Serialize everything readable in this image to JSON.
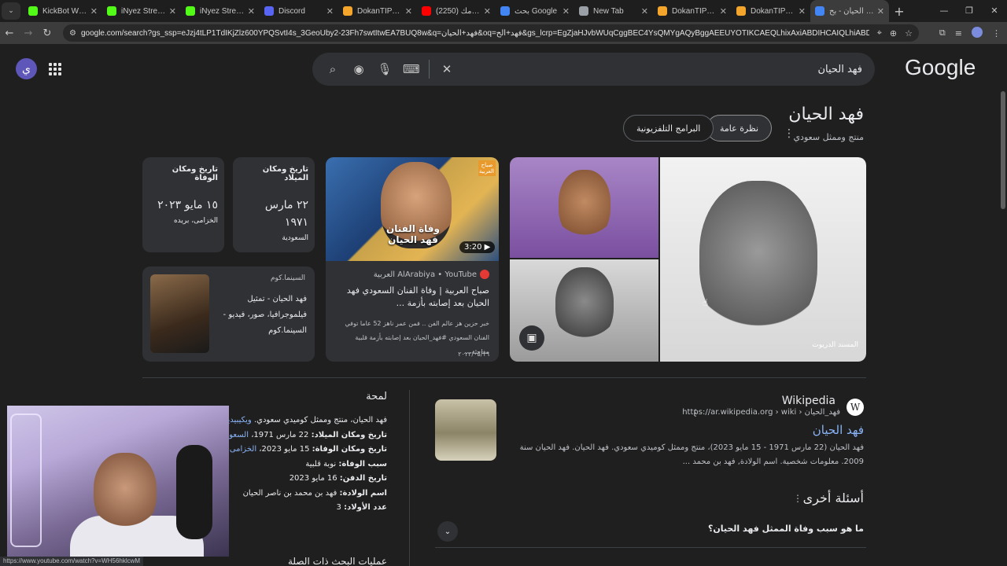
{
  "browser": {
    "tabs": [
      {
        "title": "KickBot Widget",
        "color": "#53fc18"
      },
      {
        "title": "iNyez Stream",
        "color": "#53fc18"
      },
      {
        "title": "iNyez Stream",
        "color": "#53fc18"
      },
      {
        "title": "Discord",
        "color": "#5865f2"
      },
      {
        "title": "DokanTIP | bro",
        "color": "#f4a52b"
      },
      {
        "title": "(2250) نزار مك",
        "color": "#ff0000"
      },
      {
        "title": "بحث Google",
        "color": "#4285f4"
      },
      {
        "title": "New Tab",
        "color": "#9aa0a6"
      },
      {
        "title": "DokanTIP - ية",
        "color": "#f4a52b"
      },
      {
        "title": "DokanTIP | iny",
        "color": "#f4a52b"
      },
      {
        "title": "فهد الحيان - بح",
        "color": "#4285f4"
      }
    ],
    "new_tab": "+",
    "url": "google.com/search?gs_ssp=eJzj4tLP1TdIKjZlz600YPQSvtI4s_3GeoUby2-23Fh7swtItwEA7BUQ8w&q=فهد+الحيان&oq=فهد+الح&gs_lcrp=EgZjaHJvbWUqCggBEC4YsQMYgAQyBggAEEUYOTIKCAEQLhixAxiABDIHCAIQLhiABDIKCAMQLhjUAhiAB..."
  },
  "google": {
    "logo": "Google",
    "avatar_letter": "ي",
    "query": "فهد الحيان",
    "entity_title": "فهد الحيان",
    "entity_subtitle": "منتج وممثل سعودي",
    "chips": [
      "نظرة عامة",
      "البرامج التلفزيونية"
    ],
    "info_cards": [
      {
        "heading": "تاريخ ومكان الميلاد",
        "value": "٢٢ مارس ١٩٧١",
        "place": "السعودية"
      },
      {
        "heading": "تاريخ ومكان الوفاة",
        "value": "١٥ مايو ٢٠٢٣",
        "place": "الخزامى، بريده"
      }
    ],
    "site_card": {
      "source": "السينما.كوم",
      "title": "فهد الحيان - تمثيل فيلموجرافيا، صور، فيديو - السينما.كوم"
    },
    "video": {
      "badge": "صباح العربية",
      "banner": "وفاة الفنان فهد الحيان",
      "duration": "3:20",
      "source": "AlArabiya • YouTube العربية",
      "title": "صباح العربية | وفاة الفنان السعودي فهد الحيان بعد إصابته بأزمة ...",
      "desc": "خبر حزين هز عالم الفن .. فمن عمر ناهز 52 عاما توفي الفنان السعودي #فهد_الحيان بعد إصابته بأزمة قلبية مفاجئة ...",
      "date": "٢٠٢٣/٠٥/١٦"
    },
    "image_watermark": "المسند الدريوت",
    "wiki": {
      "name": "Wikipedia",
      "url": "https://ar.wikipedia.org › wiki › فهد_الحيان",
      "link": "فهد الحيان",
      "snippet": "فهد الحيان (22 مارس 1971 - 15 مايو 2023)، منتج وممثل كوميدي سعودي. فهد الحيان. فهد الحيان سنة 2009. معلومات شخصية. اسم الولادة, فهد بن محمد ..."
    },
    "paa": {
      "title": "أسئلة أخرى",
      "questions": [
        "ما هو سبب وفاة الممثل فهد الحيان؟"
      ]
    },
    "about": {
      "title": "لمحة",
      "intro": "فهد الحيان، منتج وممثل كوميدي سعودي.",
      "intro_link": "ويكيبيديا",
      "rows": [
        {
          "k": "تاريخ ومكان الميلاد:",
          "v": "22 مارس 1971،",
          "l": "السعودية"
        },
        {
          "k": "تاريخ ومكان الوفاة:",
          "v": "15 مايو 2023،",
          "l": "الخزامى، بريدة"
        },
        {
          "k": "سبب الوفاة:",
          "v": "نوبة قلبية",
          "l": ""
        },
        {
          "k": "تاريخ الدفن:",
          "v": "16 مايو 2023",
          "l": ""
        },
        {
          "k": "اسم الولادة:",
          "v": "فهد بن محمد بن ناصر الحيان",
          "l": ""
        },
        {
          "k": "عدد الأولاد:",
          "v": "3",
          "l": ""
        }
      ],
      "related": "عمليات البحث ذات الصلة"
    },
    "status_url": "https://www.youtube.com/watch?v=WH56hklcwM"
  }
}
